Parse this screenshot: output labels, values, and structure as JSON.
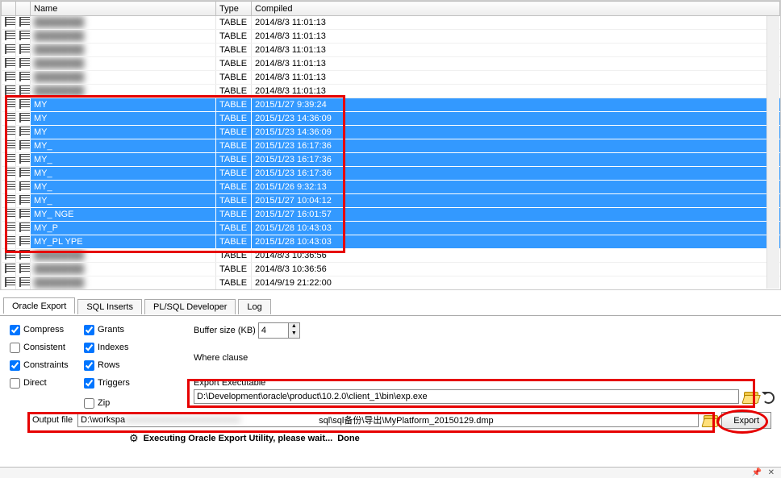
{
  "columns": {
    "name": "Name",
    "type": "Type",
    "compiled": "Compiled"
  },
  "rows": [
    {
      "name": "",
      "type": "TABLE",
      "compiled": "2014/8/3 11:01:13",
      "sel": false,
      "blur": true
    },
    {
      "name": "",
      "type": "TABLE",
      "compiled": "2014/8/3 11:01:13",
      "sel": false,
      "blur": true
    },
    {
      "name": "",
      "type": "TABLE",
      "compiled": "2014/8/3 11:01:13",
      "sel": false,
      "blur": true
    },
    {
      "name": "",
      "type": "TABLE",
      "compiled": "2014/8/3 11:01:13",
      "sel": false,
      "blur": true
    },
    {
      "name": "",
      "type": "TABLE",
      "compiled": "2014/8/3 11:01:13",
      "sel": false,
      "blur": true
    },
    {
      "name": "",
      "type": "TABLE",
      "compiled": "2014/8/3 11:01:13",
      "sel": false,
      "blur": true
    },
    {
      "name": "MY",
      "type": "TABLE",
      "compiled": "2015/1/27 9:39:24",
      "sel": true
    },
    {
      "name": "MY",
      "type": "TABLE",
      "compiled": "2015/1/23 14:36:09",
      "sel": true
    },
    {
      "name": "MY",
      "type": "TABLE",
      "compiled": "2015/1/23 14:36:09",
      "sel": true
    },
    {
      "name": "MY_",
      "type": "TABLE",
      "compiled": "2015/1/23 16:17:36",
      "sel": true
    },
    {
      "name": "MY_",
      "type": "TABLE",
      "compiled": "2015/1/23 16:17:36",
      "sel": true
    },
    {
      "name": "MY_",
      "type": "TABLE",
      "compiled": "2015/1/23 16:17:36",
      "sel": true
    },
    {
      "name": "MY_",
      "type": "TABLE",
      "compiled": "2015/1/26 9:32:13",
      "sel": true
    },
    {
      "name": "MY_",
      "type": "TABLE",
      "compiled": "2015/1/27 10:04:12",
      "sel": true
    },
    {
      "name": "MY_                                      NGE",
      "type": "TABLE",
      "compiled": "2015/1/27 16:01:57",
      "sel": true
    },
    {
      "name": "MY_P",
      "type": "TABLE",
      "compiled": "2015/1/28 10:43:03",
      "sel": true
    },
    {
      "name": "MY_PL                                       YPE",
      "type": "TABLE",
      "compiled": "2015/1/28 10:43:03",
      "sel": true
    },
    {
      "name": "",
      "type": "TABLE",
      "compiled": "2014/8/3 10:36:56",
      "sel": false,
      "blur": true
    },
    {
      "name": "",
      "type": "TABLE",
      "compiled": "2014/8/3 10:36:56",
      "sel": false,
      "blur": true
    },
    {
      "name": "",
      "type": "TABLE",
      "compiled": "2014/9/19 21:22:00",
      "sel": false,
      "blur": true
    }
  ],
  "tabs": {
    "oracle_export": "Oracle Export",
    "sql_inserts": "SQL Inserts",
    "plsql_dev": "PL/SQL Developer",
    "log": "Log"
  },
  "options": {
    "compress": "Compress",
    "consistent": "Consistent",
    "constraints": "Constraints",
    "direct": "Direct",
    "grants": "Grants",
    "indexes": "Indexes",
    "rows": "Rows",
    "triggers": "Triggers",
    "zip": "Zip"
  },
  "checked": {
    "compress": true,
    "consistent": false,
    "constraints": true,
    "direct": false,
    "grants": true,
    "indexes": true,
    "rows": true,
    "triggers": true,
    "zip": false
  },
  "buffer": {
    "label": "Buffer size (KB)",
    "value": "4"
  },
  "where": {
    "label": "Where clause",
    "value": ""
  },
  "exe": {
    "label": "Export Executable",
    "value": "D:\\Development\\oracle\\product\\10.2.0\\client_1\\bin\\exp.exe"
  },
  "output": {
    "label": "Output file",
    "prefix": "D:\\workspa",
    "suffix": "sql\\sql备份\\导出\\MyPlatform_20150129.dmp"
  },
  "export_btn": "Export",
  "status": {
    "text": "Executing Oracle Export Utility, please wait...",
    "done": "Done"
  }
}
